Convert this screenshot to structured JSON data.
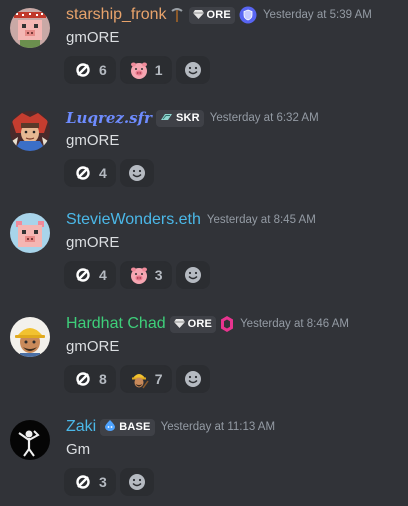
{
  "colors": {
    "background": "#313338",
    "reaction_bg": "#2b2d31",
    "timestamp": "#949ba4",
    "text": "#dbdee1"
  },
  "messages": [
    {
      "username": "starship_fronk",
      "username_color": "#e8a36b",
      "name_decoration_icon": "pickaxe-icon",
      "tag": {
        "icon": "gem-icon",
        "label": "ORE"
      },
      "role_badge_icon": "shield-badge-icon",
      "timestamp": "Yesterday at 5:39 AM",
      "content": "gmORE",
      "avatar_icon": "pig-avatar-icon",
      "reactions": [
        {
          "icon": "ore-o-icon",
          "count": "6"
        },
        {
          "icon": "pig-face-icon",
          "count": "1"
        }
      ]
    },
    {
      "username": "Luqrez.sfr",
      "username_color": "#6e8cff",
      "tag": {
        "icon": "seeker-icon",
        "label": "SKR"
      },
      "timestamp": "Yesterday at 6:32 AM",
      "content": "gmORE",
      "avatar_icon": "warrior-avatar-icon",
      "reactions": [
        {
          "icon": "ore-o-icon",
          "count": "4"
        }
      ]
    },
    {
      "username": "StevieWonders.eth",
      "username_color": "#4bb8e8",
      "timestamp": "Yesterday at 8:45 AM",
      "content": "gmORE",
      "avatar_icon": "pig-avatar-icon",
      "reactions": [
        {
          "icon": "ore-o-icon",
          "count": "4"
        },
        {
          "icon": "pig-face-icon",
          "count": "3"
        }
      ]
    },
    {
      "username": "Hardhat Chad",
      "username_color": "#3ecf7a",
      "tag": {
        "icon": "gem-icon",
        "label": "ORE"
      },
      "role_badge_icon": "hexagon-badge-icon",
      "timestamp": "Yesterday at 8:46 AM",
      "content": "gmORE",
      "avatar_icon": "hardhat-avatar-icon",
      "reactions": [
        {
          "icon": "ore-o-icon",
          "count": "8"
        },
        {
          "icon": "hardhat-miner-icon",
          "count": "7"
        }
      ]
    },
    {
      "username": "Zaki",
      "username_color": "#4bb8e8",
      "tag": {
        "icon": "base-drop-icon",
        "label": "BASE"
      },
      "timestamp": "Yesterday at 11:13 AM",
      "content": "Gm",
      "avatar_icon": "dab-avatar-icon",
      "reactions": [
        {
          "icon": "ore-o-icon",
          "count": "3"
        }
      ]
    }
  ]
}
